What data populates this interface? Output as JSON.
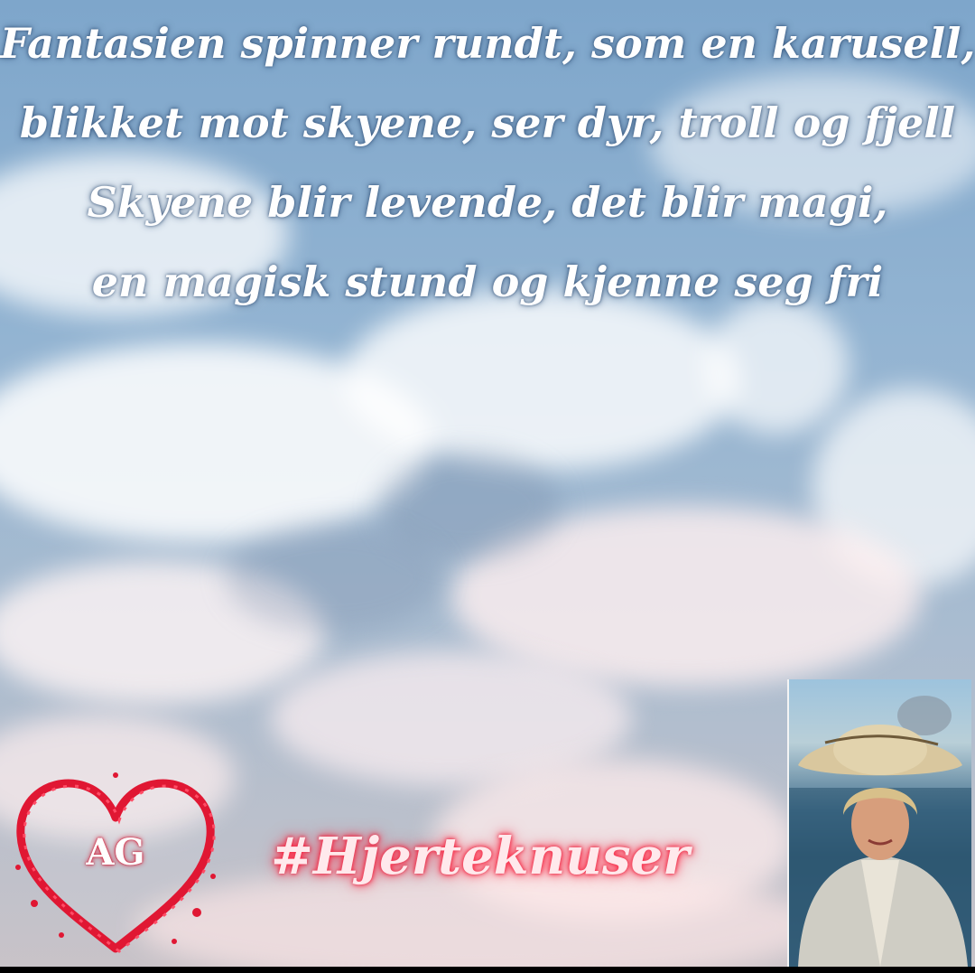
{
  "poem": {
    "lines": [
      "Fantasien spinner rundt, som en karusell,",
      "blikket mot skyene, ser dyr, troll og fjell",
      "Skyene blir levende, det blir magi,",
      "en magisk stund og kjenne seg fri"
    ]
  },
  "logo": {
    "initials": "AG",
    "color": "#e01733"
  },
  "hashtag": "#Hjerteknuser"
}
